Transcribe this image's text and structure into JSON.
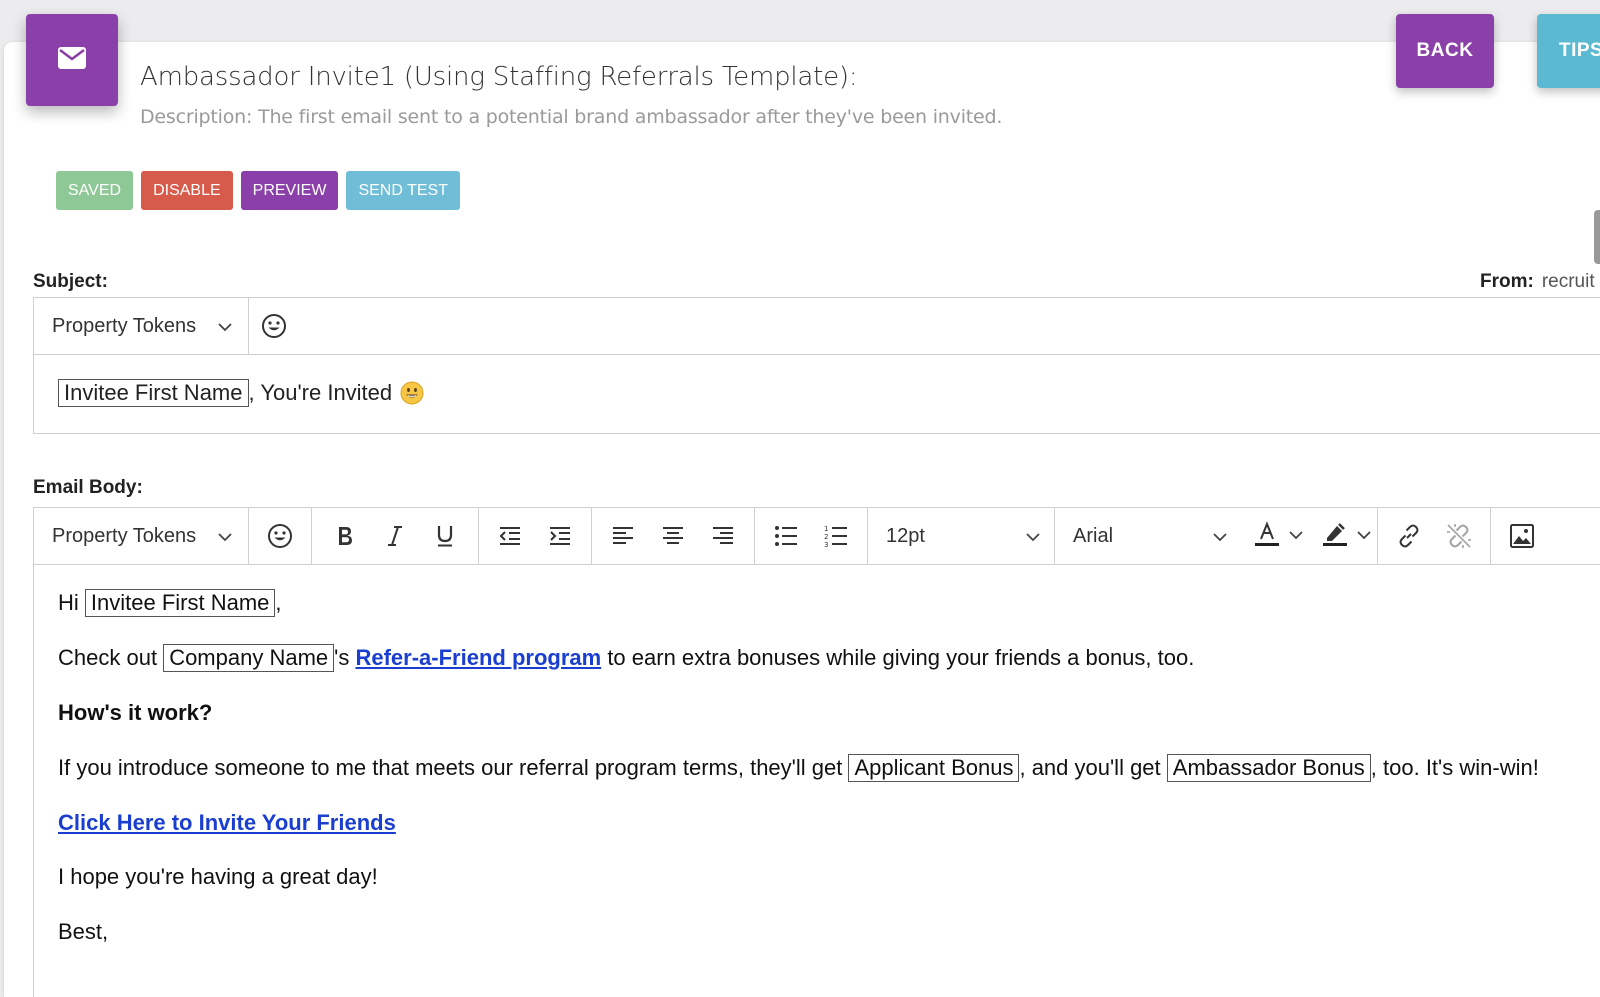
{
  "header": {
    "title": "Ambassador Invite1 (Using Staffing Referrals Template):",
    "description": "Description: The first email sent to a potential brand ambassador after they've been invited."
  },
  "top_buttons": {
    "back": "BACK",
    "tips": "TIPS"
  },
  "actions": {
    "saved": "SAVED",
    "disable": "DISABLE",
    "preview": "PREVIEW",
    "send_test": "SEND TEST"
  },
  "subject": {
    "label": "Subject:",
    "from_label": "From:",
    "from_value": "recruit",
    "property_tokens": "Property Tokens",
    "token": "Invitee First Name",
    "text": ", You're Invited",
    "emoji": "grinning-face"
  },
  "body": {
    "label": "Email Body:",
    "property_tokens": "Property Tokens",
    "font_size": "12pt",
    "font_family": "Arial",
    "greeting_prefix": "Hi",
    "greeting_token": "Invitee First Name",
    "greeting_suffix": ",",
    "p2_prefix": "Check out",
    "p2_token": "Company Name",
    "p2_mid": "'s",
    "p2_link": "Refer-a-Friend program",
    "p2_suffix": "to earn extra bonuses while giving your friends a bonus, too.",
    "heading": "How's it work?",
    "p4_prefix": "If you introduce someone to me that meets our referral program terms, they'll get",
    "p4_token1": "Applicant Bonus",
    "p4_mid": ", and you'll get",
    "p4_token2": "Ambassador Bonus",
    "p4_suffix": ", too. It's win-win!",
    "cta_link": "Click Here to Invite Your Friends",
    "closing_line": "I hope you're having a great day!",
    "signoff": "Best,"
  },
  "colors": {
    "purple": "#8b3fa8",
    "teal": "#5bbad1",
    "green": "#8fc897",
    "red": "#d75b4a",
    "link": "#1a3fd0"
  }
}
